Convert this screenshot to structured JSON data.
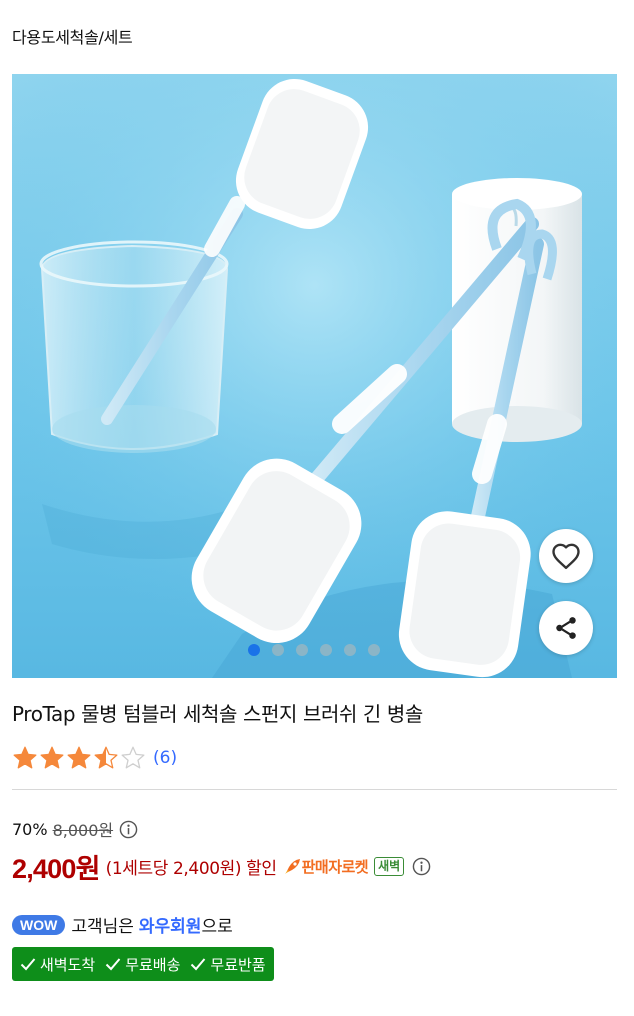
{
  "breadcrumb": "다용도세척솔/세트",
  "gallery": {
    "dot_count": 6,
    "active_index": 0
  },
  "product": {
    "title": "ProTap 물병 텀블러 세척솔 스펀지 브러쉬 긴 병솔",
    "rating": 3.5,
    "review_count": "(6)"
  },
  "pricing": {
    "discount_rate": "70%",
    "original_price": "8,000원",
    "sale_price": "2,400원",
    "unit_price": "(1세트당 2,400원) 할인",
    "rocket_label": "판매자로켓",
    "dawn_badge": "새벽"
  },
  "membership": {
    "wow_badge": "WOW",
    "text_before": "고객님은",
    "text_strong": "와우회원",
    "text_after": "으로"
  },
  "benefits": [
    "새벽도착",
    "무료배송",
    "무료반품"
  ],
  "colors": {
    "price_red": "#ae0000",
    "link_blue": "#346aff",
    "rocket_orange": "#f26d21",
    "benefit_green": "#0e8e1a",
    "star_orange": "#f5883b"
  }
}
